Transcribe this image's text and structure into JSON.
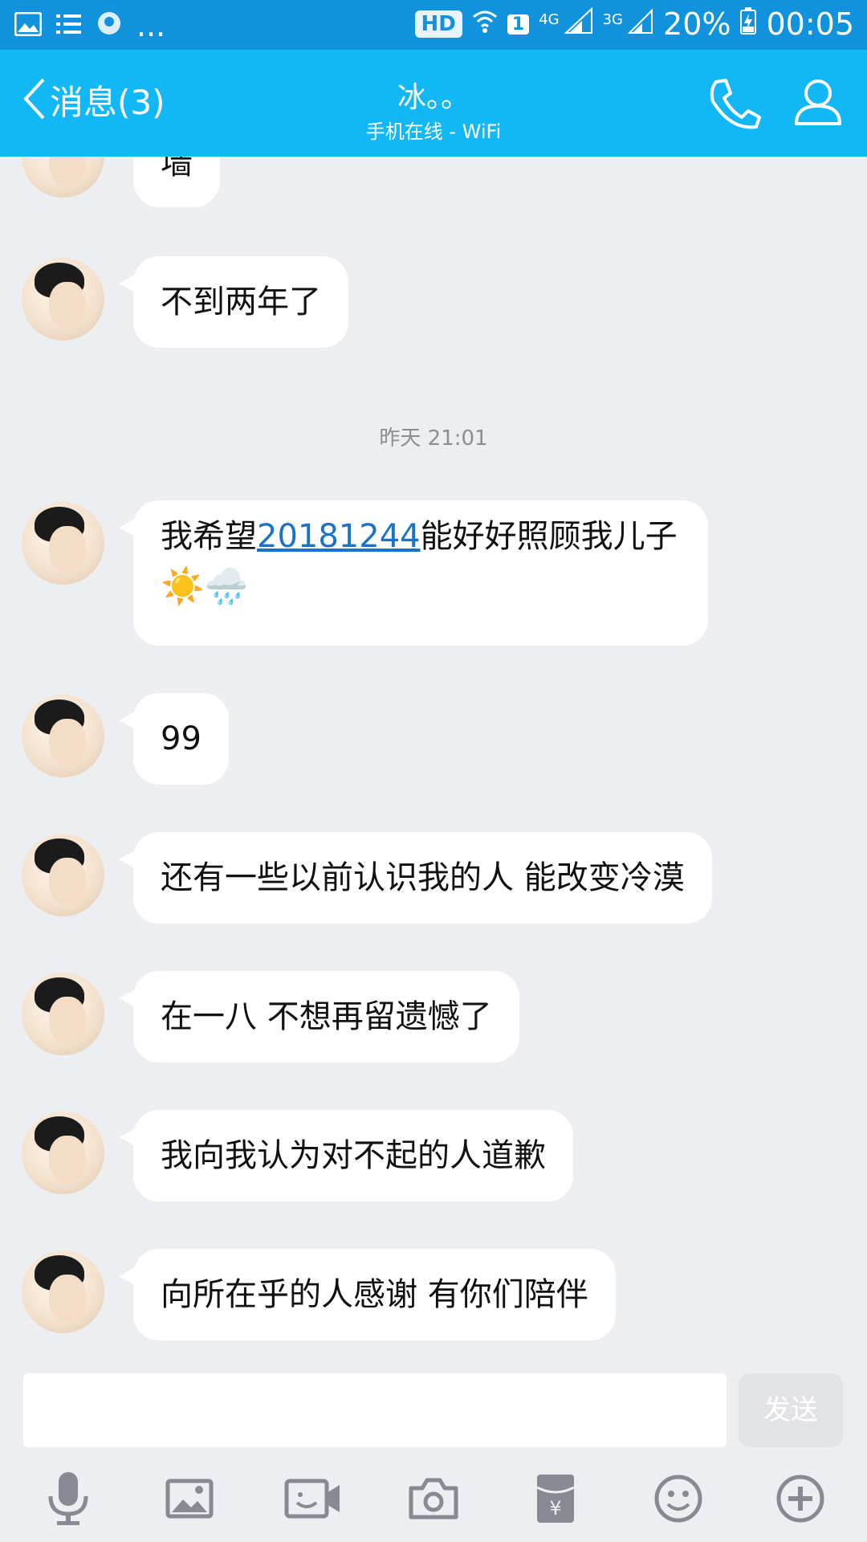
{
  "status_bar": {
    "hd": "HD",
    "sim": "1",
    "net_4g": "4G",
    "net_3g": "3G",
    "battery": "20%",
    "time": "00:05",
    "more": "..."
  },
  "header": {
    "back_label": "消息(3)",
    "contact_name": "冰。。",
    "status": "手机在线 - WiFi"
  },
  "messages": {
    "m0": "墙",
    "m1": "不到两年了",
    "timestamp": "昨天 21:01",
    "m2_pre": "我希望",
    "m2_link": "20181244",
    "m2_post": "能好好照顾我儿子",
    "m2_emoji": "☀️🌧️",
    "m3": "99",
    "m4": "还有一些以前认识我的人 能改变冷漠",
    "m5": "在一八 不想再留遗憾了",
    "m6": "我向我认为对不起的人道歉",
    "m7": "向所在乎的人感谢 有你们陪伴"
  },
  "input": {
    "placeholder": "",
    "send_label": "发送"
  },
  "colors": {
    "status_bar": "#1192dd",
    "title_bar": "#12b7f5",
    "chat_bg": "#edeef2",
    "link": "#1a73c8"
  },
  "toolbar_icons": [
    "microphone-icon",
    "image-icon",
    "video-call-icon",
    "camera-icon",
    "red-packet-icon",
    "emoji-icon",
    "plus-icon"
  ]
}
